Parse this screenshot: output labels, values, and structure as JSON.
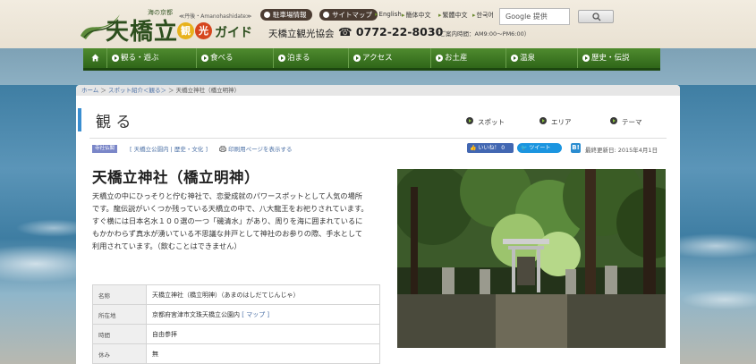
{
  "header": {
    "logo_tagline": "海の京都",
    "logo_area": "≪丹後・Amanohashidate≫",
    "logo_title": "天橋立",
    "logo_badge_1": "観",
    "logo_badge_2": "光",
    "logo_guide": "ガイド",
    "parking_link": "駐車場情報",
    "sitemap_link": "サイトマップ",
    "languages": [
      "English",
      "簡体中文",
      "繁體中文",
      "한국어"
    ],
    "association": "天橋立観光協会",
    "phone": "☎ 0772-22-8030",
    "hours": "（ご案内時間：AM9:00〜PM6:00）",
    "search_placeholder": "Google 提供"
  },
  "nav": {
    "items": [
      "観る・遊ぶ",
      "食べる",
      "泊まる",
      "アクセス",
      "お土産",
      "温泉",
      "歴史・伝説"
    ]
  },
  "breadcrumb": {
    "home": "ホーム",
    "spots": "スポット紹介＜観る＞",
    "current": "天橋立神社（橋立明神）",
    "sep": " ＞ "
  },
  "page": {
    "title": "観 る",
    "sub_tabs": [
      "スポット",
      "エリア",
      "テーマ"
    ]
  },
  "meta": {
    "category_badge": "寺社仏閣",
    "tags": "[ 天橋立公園内 | 歴史・文化 ]",
    "print_link": "印刷用ページを表示する",
    "like_label": "👍 いいね！ 0",
    "tweet_label": "🐦 ツイート",
    "hatena_label": "B!",
    "updated": "最終更新日: 2015年4月1日"
  },
  "spot": {
    "title": "天橋立神社（橋立明神）",
    "description": "天橋立の中にひっそりと佇む神社で、恋愛成就のパワースポットとして人気の場所です。龍伝説がいくつか残っている天橋立の中で、八大龍王をお祀りされています。すぐ横には日本名水１００選の一つ「磯清水」があり、周りを海に囲まれているにもかかわらず真水が湧いている不思議な井戸として神社のお参りの際、手水として利用されています。（飲むことはできません）"
  },
  "info_table": {
    "rows": [
      {
        "key": "名称",
        "value": "天橋立神社（橋立明神）（あまのはしだてじんじゃ）"
      },
      {
        "key": "所在地",
        "value": "京都府宮津市文珠天橋立公園内",
        "link": "[ マップ ]"
      },
      {
        "key": "時間",
        "value": "自由参拝"
      },
      {
        "key": "休み",
        "value": "無"
      }
    ]
  },
  "colors": {
    "nav_green": "#2f6619",
    "accent_blue": "#3a8ed0",
    "link_blue": "#4a6fa5"
  }
}
